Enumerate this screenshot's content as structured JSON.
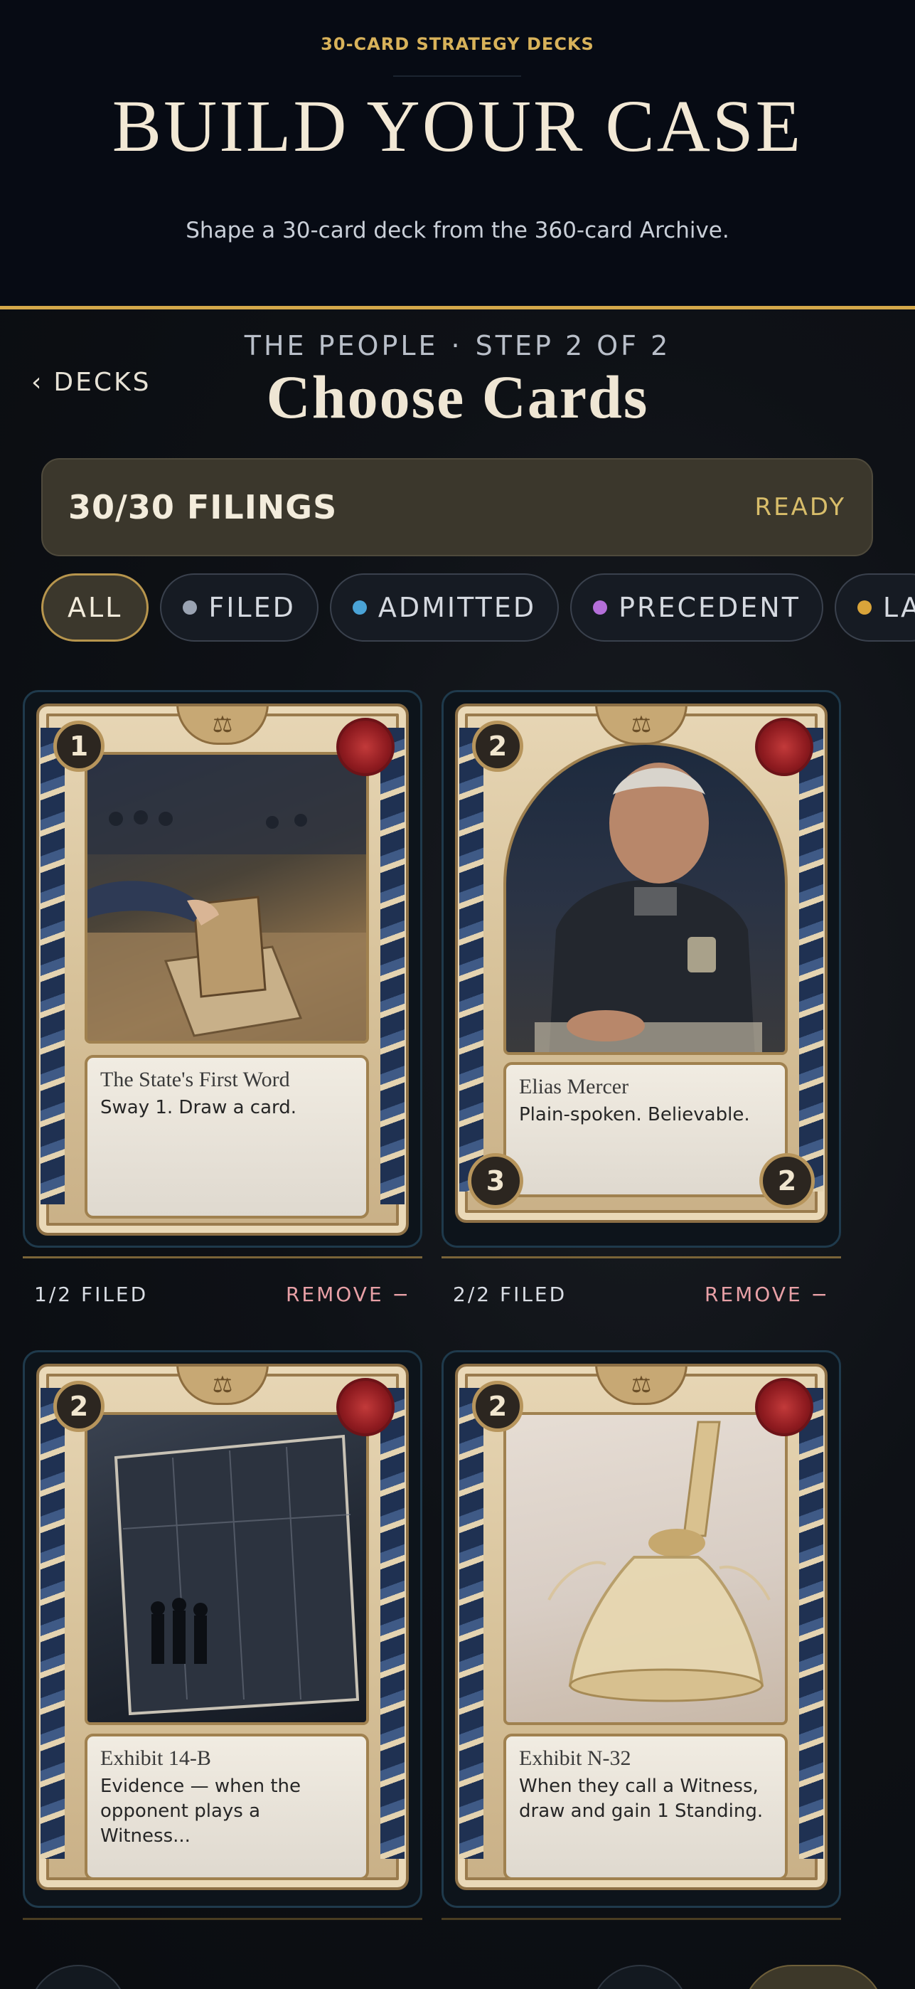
{
  "hero": {
    "kicker": "30-CARD STRATEGY DECKS",
    "title": "BUILD YOUR CASE",
    "subtitle": "Shape a 30-card deck from the 360-card Archive."
  },
  "builder": {
    "back_label": "DECKS",
    "faction": "THE PEOPLE",
    "step": "STEP 2 OF 2",
    "title": "Choose Cards",
    "count": "30/30 FILINGS",
    "status": "READY",
    "filters": [
      {
        "label": "ALL",
        "active": true,
        "color": ""
      },
      {
        "label": "FILED",
        "active": false,
        "color": "#9aa3b2"
      },
      {
        "label": "ADMITTED",
        "active": false,
        "color": "#4aa3d6"
      },
      {
        "label": "PRECEDENT",
        "active": false,
        "color": "#b46fd9"
      },
      {
        "label": "LA",
        "active": false,
        "color": "#d9a43a"
      }
    ]
  },
  "cards": [
    {
      "name": "The State's First Word",
      "text": "Sway 1. Draw a card.",
      "cost": "1",
      "stat_left": "",
      "stat_right": "",
      "filed": "1/2 FILED",
      "action": "REMOVE −",
      "art": "courtroom-document-icon"
    },
    {
      "name": "Elias Mercer",
      "text": "Plain-spoken. Believable.",
      "cost": "2",
      "stat_left": "3",
      "stat_right": "2",
      "filed": "2/2 FILED",
      "action": "REMOVE −",
      "art": "police-officer-icon"
    },
    {
      "name": "Exhibit 14-B",
      "text": "Evidence — when the opponent plays a Witness...",
      "cost": "2",
      "stat_left": "",
      "stat_right": "",
      "filed": "",
      "action": "",
      "art": "photograph-icon"
    },
    {
      "name": "Exhibit N-32",
      "text": "When they call a Witness, draw and gain 1 Standing.",
      "cost": "2",
      "stat_left": "",
      "stat_right": "",
      "filed": "",
      "action": "",
      "art": "bell-icon"
    }
  ],
  "colors": {
    "gold": "#d4a84a",
    "remove": "#e8a0a6",
    "ready": "#d8bd6a"
  }
}
